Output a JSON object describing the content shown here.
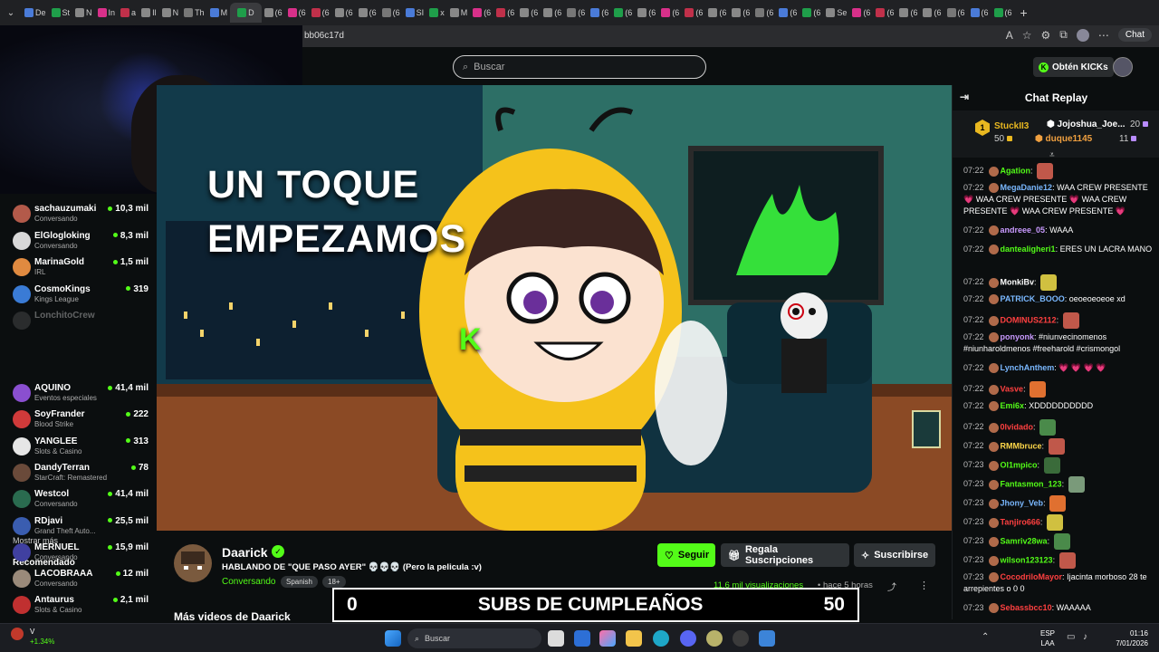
{
  "browser": {
    "tabs": [
      "De",
      "St",
      "N",
      "In",
      "a",
      "Il",
      "N",
      "Th",
      "M",
      "D",
      "(6",
      "(6",
      "(6",
      "(6",
      "(6",
      "(6",
      "SI",
      "x",
      "M",
      "(6",
      "(6",
      "(6",
      "(6",
      "(6",
      "(6",
      "(6",
      "(6",
      "(6",
      "(6",
      "(6",
      "(6",
      "(6",
      "(6",
      "(6",
      "Se",
      "(6",
      "(6",
      "(6",
      "(6",
      "(6",
      "(6",
      "(6"
    ],
    "active_tab": "D",
    "url_fragment": "bb06c17d",
    "chat_button": "Chat"
  },
  "nav": {
    "search_placeholder": "Buscar",
    "kicks_label": "Obtén KICKs"
  },
  "sidebar": {
    "following": [
      {
        "name": "sachauzumaki",
        "category": "Conversando",
        "viewers": "10,3 mil",
        "color": "#b35a4a"
      },
      {
        "name": "ElGlogloking",
        "category": "Conversando",
        "viewers": "8,3 mil",
        "color": "#d8d8d8"
      },
      {
        "name": "MarinaGold",
        "category": "IRL",
        "viewers": "1,5 mil",
        "color": "#e08a40"
      },
      {
        "name": "CosmoKings",
        "category": "Kings League",
        "viewers": "319",
        "color": "#3a7bd5"
      },
      {
        "name": "LonchitoCrew",
        "category": "",
        "viewers": "",
        "color": "#666"
      }
    ],
    "show_more": "Mostrar más",
    "recommended_label": "Recomendado",
    "recommended": [
      {
        "name": "AQUINO",
        "category": "Eventos especiales",
        "viewers": "41,4 mil",
        "color": "#8a4fd0"
      },
      {
        "name": "SoyFrander",
        "category": "Blood Strike",
        "viewers": "222",
        "color": "#d03a3a"
      },
      {
        "name": "YANGLEE",
        "category": "Slots & Casino",
        "viewers": "313",
        "color": "#e6e6e6"
      },
      {
        "name": "DandyTerran",
        "category": "StarCraft: Remastered",
        "viewers": "78",
        "color": "#6a4a3a"
      },
      {
        "name": "Westcol",
        "category": "Conversando",
        "viewers": "41,4 mil",
        "color": "#2a6b4f"
      },
      {
        "name": "RDjavi",
        "category": "Grand Theft Auto...",
        "viewers": "25,5 mil",
        "color": "#3a5db0"
      },
      {
        "name": "MERNUEL",
        "category": "Conversando",
        "viewers": "15,9 mil",
        "color": "#4040a0"
      },
      {
        "name": "LACOBRAAA",
        "category": "Conversando",
        "viewers": "12 mil",
        "color": "#9a8a7a"
      },
      {
        "name": "Antaurus",
        "category": "Slots & Casino",
        "viewers": "2,1 mil",
        "color": "#c03030"
      }
    ]
  },
  "video": {
    "overlay_line1": "UN TOQUE",
    "overlay_line2": "EMPEZAMOS",
    "bubble_letter": "K"
  },
  "stream": {
    "channel": "Daarick",
    "title": "HABLANDO DE \"QUE PASO AYER\" 💀💀💀 (Pero la pelicula :v)",
    "category": "Conversando",
    "tags": [
      "Spanish",
      "18+"
    ],
    "follow": "Seguir",
    "gift": "Regala Suscripciones",
    "subscribe": "Suscribirse",
    "views": "11.6 mil visualizaciones",
    "separator": "•",
    "ago": "hace 5 horas",
    "more_videos": "Más videos de Daarick"
  },
  "subs_overlay": {
    "left": "0",
    "title": "SUBS DE CUMPLEAÑOS",
    "right": "50"
  },
  "chat": {
    "title": "Chat Replay",
    "leaderboard": [
      {
        "rank": "1",
        "name": "StuckII3",
        "value": "50"
      },
      {
        "name": "Jojoshua_Joe...",
        "value": "20"
      },
      {
        "name": "duque1145",
        "value": "11"
      }
    ],
    "messages": [
      {
        "t": "07:22",
        "u": "Agation",
        "c": "#53fc18",
        "m": ""
      },
      {
        "t": "07:22",
        "u": "MegaDanie12",
        "c": "#7ab8ff",
        "m": "WAA CREW PRESENTE 💗 WAA CREW PRESENTE 💗 WAA CREW PRESENTE 💗 WAA CREW PRESENTE 💗"
      },
      {
        "t": "07:22",
        "u": "andreee_05",
        "c": "#c99aff",
        "m": "WAAA"
      },
      {
        "t": "07:22",
        "u": "dantealigheri1",
        "c": "#53fc18",
        "m": "ERES UN LACRA MANO"
      },
      {
        "t": "07:22",
        "u": "MonkiBv",
        "c": "#ffffff",
        "m": ""
      },
      {
        "t": "07:22",
        "u": "PATRICK_BOOO",
        "c": "#7ab8ff",
        "m": "oeoeoeoeoe xd"
      },
      {
        "t": "07:22",
        "u": "DOMINUS2112",
        "c": "#ff4040",
        "m": ""
      },
      {
        "t": "07:22",
        "u": "ponyonk",
        "c": "#c99aff",
        "m": "#niunvecinomenos #niunharoldmenos #freeharold #crismongol"
      },
      {
        "t": "07:22",
        "u": "LynchAnthem",
        "c": "#7ab8ff",
        "m": "💗 💗 💗 💗"
      },
      {
        "t": "07:22",
        "u": "Vasve",
        "c": "#ff4040",
        "m": ""
      },
      {
        "t": "07:22",
        "u": "Emi6x",
        "c": "#53fc18",
        "m": "XDDDDDDDDDD"
      },
      {
        "t": "07:22",
        "u": "0lvidado",
        "c": "#ff4040",
        "m": ""
      },
      {
        "t": "07:22",
        "u": "RMMbruce",
        "c": "#ffd84a",
        "m": ""
      },
      {
        "t": "07:23",
        "u": "Ol1mpico",
        "c": "#53fc18",
        "m": ""
      },
      {
        "t": "07:23",
        "u": "Fantasmon_123",
        "c": "#53fc18",
        "m": ""
      },
      {
        "t": "07:23",
        "u": "Jhony_Veb",
        "c": "#7ab8ff",
        "m": ""
      },
      {
        "t": "07:23",
        "u": "Tanjiro666",
        "c": "#ff4040",
        "m": ""
      },
      {
        "t": "07:23",
        "u": "Samriv28wa",
        "c": "#53fc18",
        "m": ""
      },
      {
        "t": "07:23",
        "u": "wilson123123",
        "c": "#53fc18",
        "m": ""
      },
      {
        "t": "07:23",
        "u": "CocodriloMayor",
        "c": "#ff4040",
        "m": "Ijacinta morboso 28 te arrepientes o 0 0"
      },
      {
        "t": "07:23",
        "u": "Sebassbcc10",
        "c": "#ff4040",
        "m": "WAAAAA"
      }
    ]
  },
  "taskbar": {
    "search": "Buscar",
    "stock_name": "V",
    "stock_change": "+1.34%",
    "lang1": "ESP",
    "lang2": "LAA",
    "time": "01:16",
    "date": "7/01/2026"
  }
}
